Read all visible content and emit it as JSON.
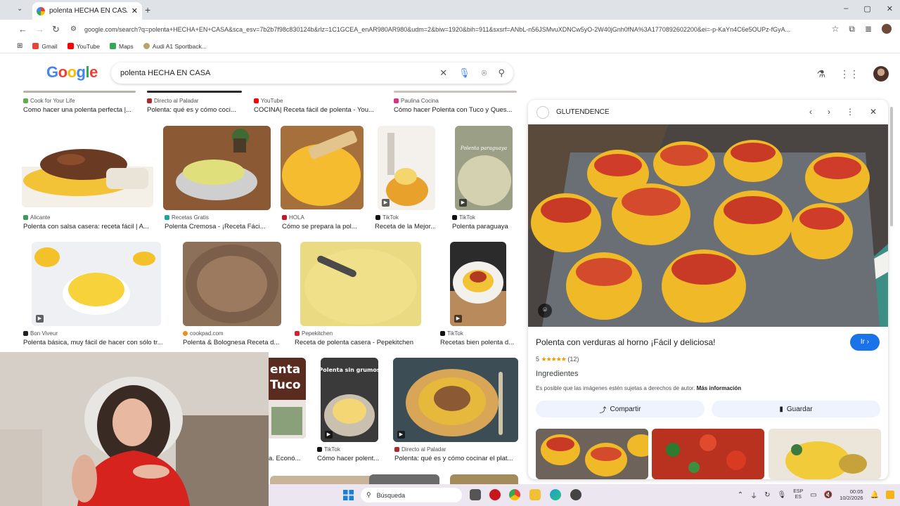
{
  "browser": {
    "tab_title": "polenta HECHA EN CASA - Bus",
    "url": "google.com/search?q=polenta+HECHA+EN+CASA&sca_esv=7b2b7f98c830124b&rlz=1C1GCEA_enAR980AR980&udm=2&biw=1920&bih=911&sxsrf=ANbL-n56JSMvuXDNCw5yO-2W40jGnh0fNA%3A1770892602200&ei=-p-KaYn4C6e5OUPz-fGyA...",
    "bookmarks": [
      "Gmail",
      "YouTube",
      "Maps",
      "Audi A1 Sportback..."
    ]
  },
  "google": {
    "logo": "Google",
    "query": "polenta HECHA EN CASA"
  },
  "results": {
    "row0": [
      {
        "source": "Cook for Your Life",
        "caption": "Como hacer una polenta perfecta |..."
      },
      {
        "source": "Directo al Paladar",
        "caption": "Polenta: qué es y cómo coci..."
      },
      {
        "source": "YouTube",
        "caption": "COCINA| Receta fácil de polenta - You..."
      },
      {
        "source": "Paulina Cocina",
        "caption": "Cómo hacer Polenta con Tuco y Ques..."
      }
    ],
    "row1": [
      {
        "source": "Alicante",
        "caption": "Polenta con salsa casera: receta fácil | A..."
      },
      {
        "source": "Recetas Gratis",
        "caption": "Polenta Cremosa - ¡Receta Fáci..."
      },
      {
        "source": "HOLA",
        "caption": "Cómo se prepara la pol..."
      },
      {
        "source": "TikTok",
        "caption": "Receta de la Mejor..."
      },
      {
        "source": "TikTok",
        "caption": "Polenta paraguaya",
        "overlay": "Polenta paraguaya"
      }
    ],
    "row2": [
      {
        "source": "Bon Viveur",
        "caption": "Polenta básica, muy fácil de hacer con sólo tr..."
      },
      {
        "source": "cookpad.com",
        "caption": "Polenta & Bolognesa Receta d..."
      },
      {
        "source": "Pepekitchen",
        "caption": "Receta de polenta casera - Pepekitchen"
      },
      {
        "source": "TikTok",
        "caption": "Recetas bien polenta d..."
      }
    ],
    "row3": [
      {
        "source": "",
        "caption": "a. Econó...",
        "overlay": "enta Tuco"
      },
      {
        "source": "TikTok",
        "caption": "Cómo hacer polent...",
        "overlay": "Polenta sin grumos"
      },
      {
        "source": "Directo al Paladar",
        "caption": "Polenta: qué es y cómo cocinar el plat..."
      }
    ]
  },
  "panel": {
    "site": "GLUTENDENCE",
    "title": "Polenta con verduras al horno ¡Fácil y deliciosa!",
    "go_label": "Ir",
    "rating": "5",
    "stars": "★★★★★",
    "reviews": "(12)",
    "section": "Ingredientes",
    "copyright": "Es posible que las imágenes estén sujetas a derechos de autor.",
    "more_info": "Más información",
    "share_label": "Compartir",
    "save_label": "Guardar"
  },
  "taskbar": {
    "search_placeholder": "Búsqueda",
    "lang_top": "ESP",
    "lang_bottom": "ES",
    "time": "00:05",
    "date": "10/2/2026"
  },
  "colors": {
    "accent": "#1a73e8",
    "polenta": "#f3c430",
    "tab_strip": "#dfe3e8"
  }
}
